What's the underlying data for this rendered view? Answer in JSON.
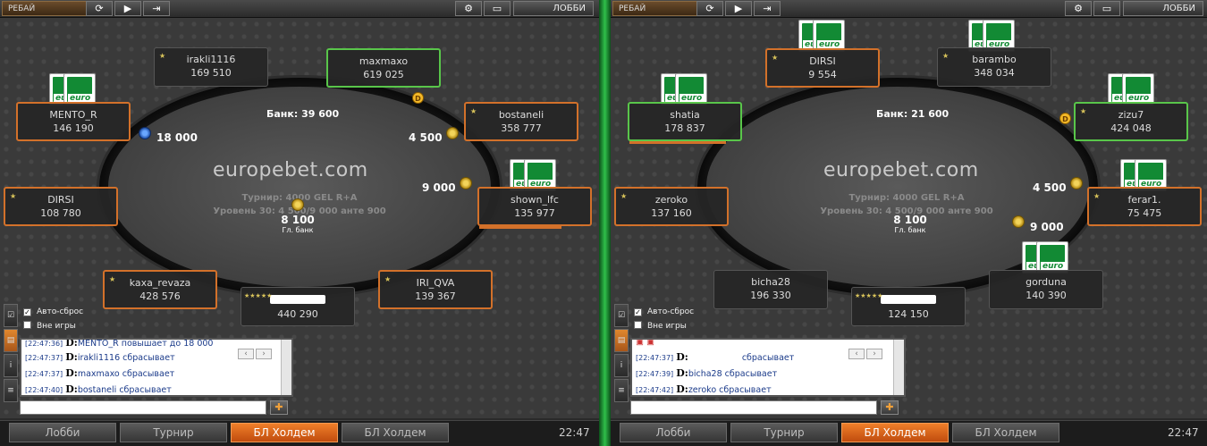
{
  "left": {
    "toolbar": {
      "rebuy": "РЕБАЙ",
      "lobby": "ЛОББИ"
    },
    "bank": "Банк: 39 600",
    "brand": {
      "a": "europebet",
      "b": ".com"
    },
    "tourney_line": "Турнир: 4000 GEL R+A",
    "level_line": "Уровень 30: 4 500/9 000 анте 900",
    "main_pot": {
      "amount": "8 100",
      "label": "Гл. банк"
    },
    "seats": {
      "irakli": {
        "name": "irakli1116",
        "stack": "169 510"
      },
      "maxmaxo": {
        "name": "maxmaxo",
        "stack": "619 025"
      },
      "mento": {
        "name": "MENTO_R",
        "stack": "146 190"
      },
      "bostaneli": {
        "name": "bostaneli",
        "stack": "358 777"
      },
      "dirsi": {
        "name": "DIRSI",
        "stack": "108 780"
      },
      "shown": {
        "name": "shown_lfc",
        "stack": "135 977"
      },
      "kaxa": {
        "name": "kaxa_revaza",
        "stack": "428 576"
      },
      "hero": {
        "stack": "440 290"
      },
      "iri": {
        "name": "IRI_QVA",
        "stack": "139 367"
      }
    },
    "bets": {
      "mento": "18 000",
      "bostaneli": "4 500",
      "shown": "9 000"
    },
    "checkboxes": {
      "auto": "Авто-сброс",
      "out": "Вне игры"
    },
    "chat": [
      {
        "time": "[22:47:36]",
        "text": "MENTO_R  повышает до 18 000"
      },
      {
        "time": "[22:47:37]",
        "text": "irakli1116  сбрасывает"
      },
      {
        "time": "[22:47:37]",
        "text": "maxmaxo  сбрасывает"
      },
      {
        "time": "[22:47:40]",
        "text": "bostaneli  сбрасывает"
      }
    ],
    "tabs": [
      "Лобби",
      "Турнир",
      "БЛ Холдем",
      "БЛ Холдем"
    ],
    "clock": "22:47"
  },
  "right": {
    "toolbar": {
      "rebuy": "РЕБАЙ",
      "lobby": "ЛОББИ"
    },
    "bank": "Банк: 21 600",
    "brand": {
      "a": "europebet",
      "b": ".com"
    },
    "tourney_line": "Турнир: 4000 GEL R+A",
    "level_line": "Уровень 30: 4 500/9 000 анте 900",
    "main_pot": {
      "amount": "8 100",
      "label": "Гл. банк"
    },
    "seats": {
      "dirsi": {
        "name": "DIRSI",
        "stack": "9 554"
      },
      "barambo": {
        "name": "barambo",
        "stack": "348 034"
      },
      "shatia": {
        "name": "shatia",
        "stack": "178 837"
      },
      "zizu": {
        "name": "zizu7",
        "stack": "424 048"
      },
      "zeroko": {
        "name": "zeroko",
        "stack": "137 160"
      },
      "ferar": {
        "name": "ferar1.",
        "stack": "75 475"
      },
      "bicha": {
        "name": "bicha28",
        "stack": "196 330"
      },
      "hero": {
        "stack": "124 150"
      },
      "gorduna": {
        "name": "gorduna",
        "stack": "140 390"
      }
    },
    "bets": {
      "ferar": "4 500",
      "gorduna": "9 000"
    },
    "checkboxes": {
      "auto": "Авто-сброс",
      "out": "Вне игры"
    },
    "chat": [
      {
        "time": "[22:47:37]",
        "text": "сбрасывает"
      },
      {
        "time": "[22:47:39]",
        "text": "bicha28  сбрасывает"
      },
      {
        "time": "[22:47:42]",
        "text": "zeroko  сбрасывает"
      }
    ],
    "tabs": [
      "Лобби",
      "Турнир",
      "БЛ Холдем",
      "БЛ Холдем"
    ],
    "clock": "22:47"
  },
  "card_brand": "euro",
  "dealer_letter": "D"
}
